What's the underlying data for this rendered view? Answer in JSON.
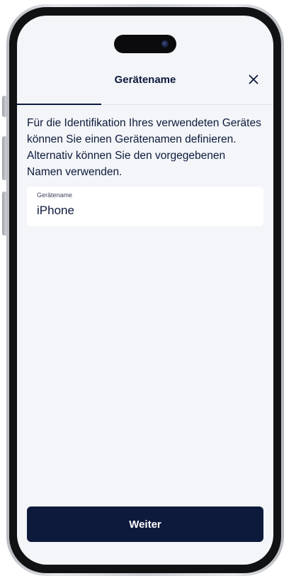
{
  "header": {
    "title": "Gerätename",
    "close_icon": "close-icon"
  },
  "progress": {
    "value": 0.33
  },
  "intro": {
    "text": "Für die Identifikation Ihres verwendeten Gerätes können Sie einen Gerätenamen definieren. Alternativ können Sie den vorgegebenen Namen verwenden."
  },
  "device_name_field": {
    "label": "Gerätename",
    "value": "iPhone"
  },
  "footer": {
    "continue_label": "Weiter"
  },
  "colors": {
    "primary": "#0e1a3c",
    "background": "#f3f5f8",
    "surface": "#ffffff"
  }
}
